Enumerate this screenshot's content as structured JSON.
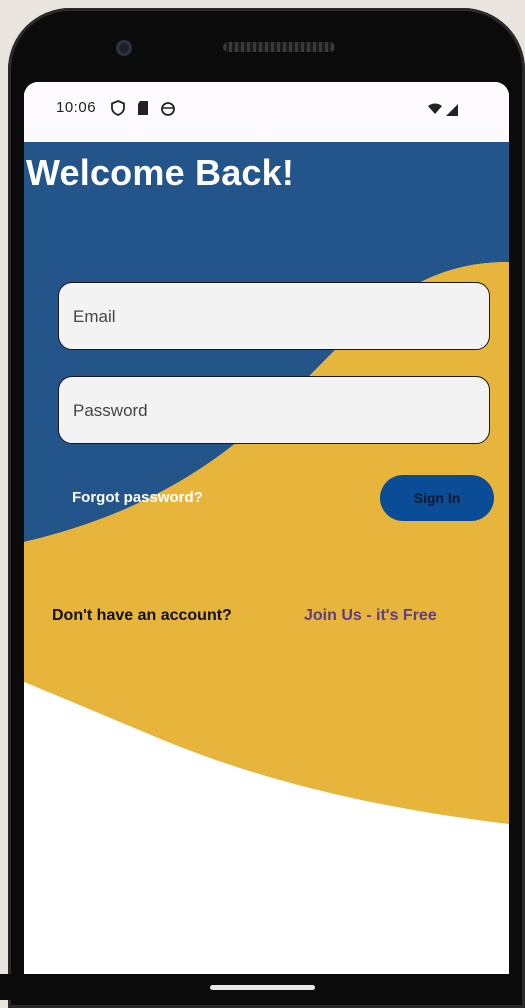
{
  "status_bar": {
    "time": "10:06",
    "icons": [
      "shield-icon",
      "sd-card-icon",
      "android-icon",
      "wifi-icon",
      "signal-icon"
    ]
  },
  "login": {
    "title": "Welcome Back!",
    "email_placeholder": "Email",
    "password_placeholder": "Password",
    "forgot_label": "Forgot password?",
    "signin_label": "Sign In"
  },
  "signup": {
    "prompt": "Don't have an account?",
    "link_label": "Join Us - it's Free"
  },
  "colors": {
    "blue": "#23558b",
    "yellow": "#e7b53c",
    "button": "#0a4c95",
    "link": "#5b3e8c"
  }
}
